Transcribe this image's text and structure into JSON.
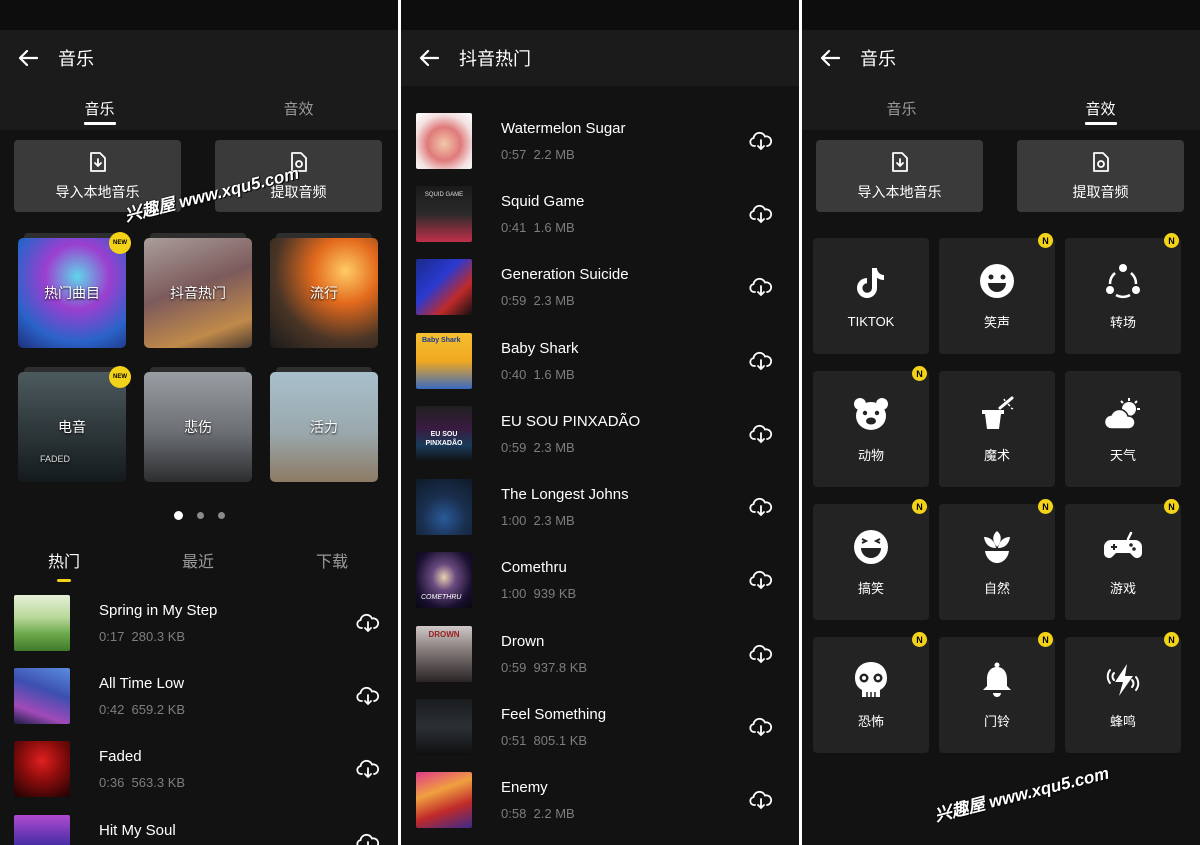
{
  "screen1": {
    "title": "音乐",
    "tabs": [
      "音乐",
      "音效"
    ],
    "actions": {
      "import": "导入本地音乐",
      "extract": "提取音频"
    },
    "categories": [
      {
        "label": "热门曲目",
        "badge": "NEW"
      },
      {
        "label": "抖音热门"
      },
      {
        "label": "流行"
      },
      {
        "label": "电音",
        "badge": "NEW",
        "art_text": "FADED"
      },
      {
        "label": "悲伤"
      },
      {
        "label": "活力"
      }
    ],
    "subtabs": [
      "热门",
      "最近",
      "下载"
    ],
    "songs": [
      {
        "name": "Spring in My Step",
        "duration": "0:17",
        "size": "280.3 KB"
      },
      {
        "name": "All Time Low",
        "duration": "0:42",
        "size": "659.2 KB"
      },
      {
        "name": "Faded",
        "duration": "0:36",
        "size": "563.3 KB"
      },
      {
        "name": "Hit My Soul",
        "duration": "",
        "size": ""
      }
    ]
  },
  "screen2": {
    "title": "抖音热门",
    "songs": [
      {
        "name": "Watermelon Sugar",
        "duration": "0:57",
        "size": "2.2 MB"
      },
      {
        "name": "Squid Game",
        "duration": "0:41",
        "size": "1.6 MB",
        "art_text": "SQUID GAME"
      },
      {
        "name": "Generation Suicide",
        "duration": "0:59",
        "size": "2.3 MB"
      },
      {
        "name": "Baby Shark",
        "duration": "0:40",
        "size": "1.6 MB",
        "art_text": "Baby Shark"
      },
      {
        "name": "EU SOU PINXADÃO",
        "duration": "0:59",
        "size": "2.3 MB",
        "art_text": "EU SOU PINXADÃO"
      },
      {
        "name": "The Longest Johns",
        "duration": "1:00",
        "size": "2.3 MB"
      },
      {
        "name": "Comethru",
        "duration": "1:00",
        "size": "939 KB",
        "art_text": "COMETHRU"
      },
      {
        "name": "Drown",
        "duration": "0:59",
        "size": "937.8 KB",
        "art_text": "DROWN"
      },
      {
        "name": "Feel Something",
        "duration": "0:51",
        "size": "805.1 KB"
      },
      {
        "name": "Enemy",
        "duration": "0:58",
        "size": "2.2 MB"
      }
    ]
  },
  "screen3": {
    "title": "音乐",
    "tabs": [
      "音乐",
      "音效"
    ],
    "actions": {
      "import": "导入本地音乐",
      "extract": "提取音频"
    },
    "effects": [
      {
        "label": "TIKTOK",
        "icon": "tiktok-icon",
        "badge": ""
      },
      {
        "label": "笑声",
        "icon": "smile-icon",
        "badge": "N"
      },
      {
        "label": "转场",
        "icon": "transition-icon",
        "badge": "N"
      },
      {
        "label": "动物",
        "icon": "bear-icon",
        "badge": "N"
      },
      {
        "label": "魔术",
        "icon": "magic-hat-icon",
        "badge": ""
      },
      {
        "label": "天气",
        "icon": "weather-icon",
        "badge": ""
      },
      {
        "label": "搞笑",
        "icon": "laugh-icon",
        "badge": "N"
      },
      {
        "label": "自然",
        "icon": "flower-icon",
        "badge": "N"
      },
      {
        "label": "游戏",
        "icon": "gamepad-icon",
        "badge": "N"
      },
      {
        "label": "恐怖",
        "icon": "skull-icon",
        "badge": "N"
      },
      {
        "label": "门铃",
        "icon": "bell-icon",
        "badge": "N"
      },
      {
        "label": "蜂鸣",
        "icon": "buzz-icon",
        "badge": "N"
      }
    ]
  },
  "watermark": "兴趣屋 www.xqu5.com",
  "colors": {
    "background": "#121212",
    "appbar": "#1b1b1b",
    "button": "#3a3a3a",
    "tile": "#232323",
    "accent": "#f3d319"
  }
}
